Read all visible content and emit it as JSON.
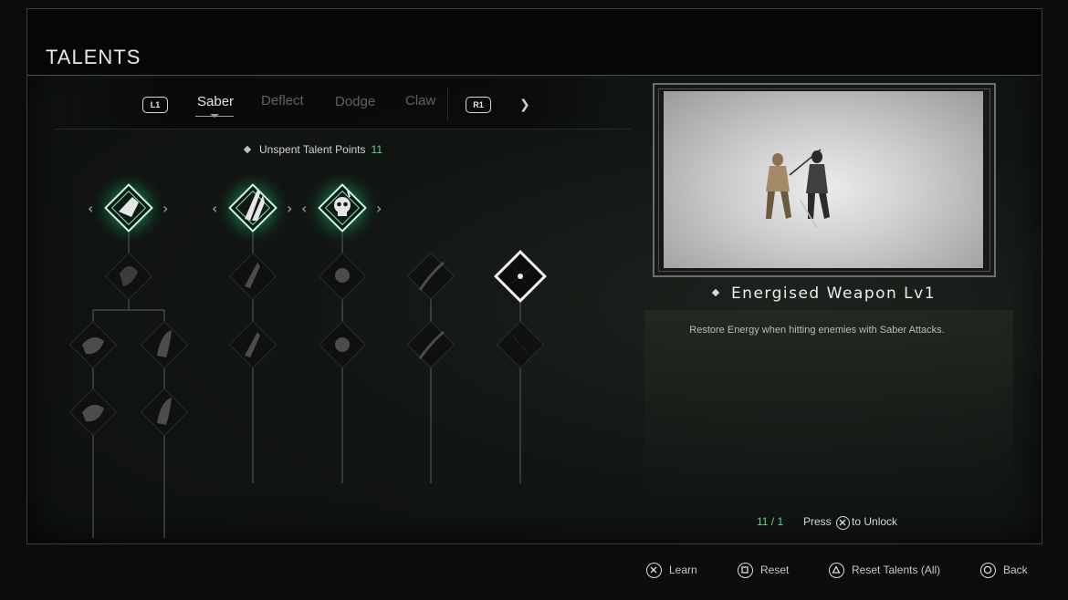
{
  "header": {
    "title": "TALENTS"
  },
  "tabs": {
    "left_bumper": "L1",
    "right_bumper": "R1",
    "items": [
      {
        "label": "Saber",
        "active": true
      },
      {
        "label": "Deflect",
        "active": false
      },
      {
        "label": "Dodge",
        "active": false
      },
      {
        "label": "Claw",
        "active": false
      }
    ]
  },
  "points": {
    "label": "Unspent Talent Points",
    "value": "11"
  },
  "tree": {
    "nodes": [
      {
        "icon": "ghost-head-icon",
        "state": "equipped"
      },
      {
        "icon": "blade-slash-icon",
        "state": "equipped"
      },
      {
        "icon": "skull-icon",
        "state": "equipped"
      },
      {
        "icon": "dark-figure-icon",
        "state": "locked"
      },
      {
        "icon": "blade-slash-icon",
        "state": "locked"
      },
      {
        "icon": "skull-icon",
        "state": "locked"
      },
      {
        "icon": "blade-arc-icon",
        "state": "locked"
      },
      {
        "icon": "pinwheel-icon",
        "state": "selected"
      },
      {
        "icon": "swirl-icon",
        "state": "locked"
      },
      {
        "icon": "dark-figure-icon",
        "state": "locked"
      },
      {
        "icon": "blade-slash-icon",
        "state": "locked"
      },
      {
        "icon": "skull-icon",
        "state": "locked"
      },
      {
        "icon": "blade-arc-icon",
        "state": "locked"
      },
      {
        "icon": "pinwheel-icon",
        "state": "locked"
      },
      {
        "icon": "swirl-icon",
        "state": "locked"
      },
      {
        "icon": "dark-figure-icon",
        "state": "locked"
      }
    ]
  },
  "detail": {
    "name": "Energised Weapon Lv1",
    "description": "Restore Energy when hitting enemies with Saber Attacks.",
    "cost": "11 / 1",
    "press_label": "Press",
    "unlock_label": "to Unlock"
  },
  "footer": {
    "learn": "Learn",
    "reset": "Reset",
    "reset_all": "Reset Talents (All)",
    "back": "Back"
  },
  "colors": {
    "accent_green": "#5fd38f",
    "glow_green": "#2fd08a"
  }
}
